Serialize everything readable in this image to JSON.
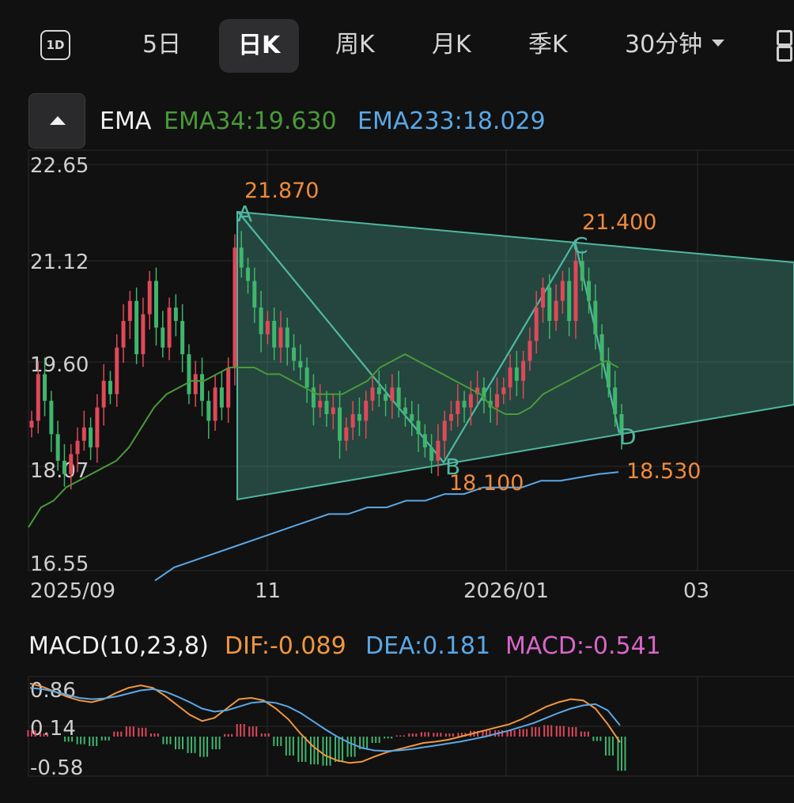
{
  "tabs": {
    "one_day": "1D",
    "items": [
      {
        "label": "5日"
      },
      {
        "label": "日K",
        "active": true
      },
      {
        "label": "周K"
      },
      {
        "label": "月K"
      },
      {
        "label": "季K"
      },
      {
        "label": "30分钟"
      }
    ]
  },
  "colors": {
    "background": "#111111",
    "up_candle": "#e0485a",
    "down_candle": "#3fb56d",
    "ema34": "#4a9a3a",
    "ema233": "#5aa8e6",
    "pattern": "#4fb8a0",
    "annotation": "#ef8a3c",
    "dif": "#f0973f",
    "dea": "#5aa8e6",
    "macd": "#d866c8"
  },
  "ema_legend": {
    "title": "EMA",
    "ema34": "EMA34:19.630",
    "ema233": "EMA233:18.029"
  },
  "macd_legend": {
    "title": "MACD(10,23,8)",
    "dif": "DIF:-0.089",
    "dea": "DEA:0.181",
    "macd": "MACD:-0.541"
  },
  "chart_data": [
    {
      "type": "candlestick",
      "title": "EMA",
      "y_ticks": [
        "22.65",
        "21.12",
        "19.60",
        "18.07",
        "16.55"
      ],
      "ylim": [
        16.55,
        22.65
      ],
      "x_ticks": [
        "2025/09",
        "11",
        "2026/01",
        "03"
      ],
      "grid": true,
      "closes": [
        18.8,
        19.5,
        19.1,
        18.6,
        18.2,
        18.0,
        18.3,
        18.5,
        18.7,
        18.4,
        19.0,
        19.4,
        19.2,
        19.9,
        20.3,
        20.6,
        19.8,
        20.4,
        20.9,
        20.2,
        19.9,
        20.5,
        20.3,
        19.8,
        19.2,
        19.5,
        19.1,
        18.8,
        19.3,
        19.0,
        19.6,
        21.4,
        21.1,
        20.9,
        20.5,
        20.1,
        20.3,
        19.9,
        20.2,
        19.9,
        19.7,
        19.6,
        19.3,
        19.0,
        19.1,
        18.9,
        19.0,
        18.5,
        18.7,
        18.9,
        18.8,
        19.1,
        19.3,
        19.2,
        19.1,
        19.3,
        19.0,
        18.9,
        18.8,
        18.6,
        18.4,
        18.2,
        18.5,
        18.8,
        18.9,
        19.1,
        19.0,
        19.2,
        19.3,
        19.1,
        19.0,
        19.2,
        19.3,
        19.6,
        19.4,
        19.7,
        20.0,
        20.5,
        20.8,
        20.3,
        20.6,
        20.9,
        20.3,
        21.2,
        20.9,
        20.6,
        20.1,
        19.7,
        19.3,
        18.9,
        18.6
      ],
      "ema34": [
        17.2,
        17.5,
        17.6,
        17.8,
        17.9,
        18.0,
        18.1,
        18.2,
        18.4,
        18.7,
        19.0,
        19.2,
        19.3,
        19.4,
        19.4,
        19.5,
        19.6,
        19.6,
        19.6,
        19.5,
        19.5,
        19.4,
        19.3,
        19.2,
        19.2,
        19.2,
        19.3,
        19.4,
        19.6,
        19.7,
        19.8,
        19.7,
        19.6,
        19.5,
        19.4,
        19.3,
        19.2,
        19.0,
        18.9,
        18.9,
        19.0,
        19.2,
        19.3,
        19.4,
        19.5,
        19.6,
        19.7,
        19.6
      ],
      "ema233": [
        16.4,
        16.6,
        16.7,
        16.8,
        16.9,
        17.0,
        17.1,
        17.2,
        17.3,
        17.4,
        17.4,
        17.5,
        17.5,
        17.6,
        17.6,
        17.7,
        17.7,
        17.8,
        17.8,
        17.8,
        17.9,
        17.9,
        17.95,
        18.0,
        18.03
      ],
      "pattern_points": [
        {
          "name": "A",
          "value": "21.870"
        },
        {
          "name": "B",
          "value": "18.100"
        },
        {
          "name": "C",
          "value": "21.400"
        },
        {
          "name": "D",
          "value": "18.530"
        }
      ]
    },
    {
      "type": "macd",
      "title": "MACD(10,23,8)",
      "y_ticks": [
        "0.86",
        "0.14",
        "-0.58"
      ],
      "ylim": [
        -0.58,
        0.86
      ],
      "series": [
        {
          "name": "DIF",
          "values": [
            0.85,
            0.8,
            0.72,
            0.64,
            0.58,
            0.55,
            0.6,
            0.7,
            0.78,
            0.82,
            0.78,
            0.65,
            0.5,
            0.35,
            0.25,
            0.3,
            0.45,
            0.6,
            0.62,
            0.58,
            0.45,
            0.28,
            0.05,
            -0.15,
            -0.3,
            -0.38,
            -0.42,
            -0.4,
            -0.32,
            -0.25,
            -0.2,
            -0.15,
            -0.1,
            -0.08,
            -0.05,
            0.0,
            0.05,
            0.1,
            0.15,
            0.2,
            0.28,
            0.38,
            0.48,
            0.55,
            0.6,
            0.58,
            0.45,
            0.2,
            -0.09
          ]
        },
        {
          "name": "DEA",
          "values": [
            0.78,
            0.76,
            0.72,
            0.67,
            0.62,
            0.6,
            0.61,
            0.64,
            0.69,
            0.74,
            0.76,
            0.72,
            0.64,
            0.55,
            0.45,
            0.4,
            0.42,
            0.48,
            0.54,
            0.56,
            0.54,
            0.48,
            0.38,
            0.25,
            0.12,
            0.0,
            -0.1,
            -0.18,
            -0.22,
            -0.23,
            -0.22,
            -0.2,
            -0.17,
            -0.14,
            -0.11,
            -0.08,
            -0.04,
            0.0,
            0.05,
            0.1,
            0.16,
            0.22,
            0.3,
            0.38,
            0.45,
            0.5,
            0.52,
            0.42,
            0.18
          ]
        }
      ],
      "histogram": [
        0.1,
        0.05,
        0.0,
        -0.08,
        -0.12,
        -0.15,
        -0.06,
        0.08,
        0.16,
        0.14,
        0.05,
        -0.12,
        -0.2,
        -0.26,
        -0.32,
        -0.2,
        0.04,
        0.2,
        0.16,
        0.05,
        -0.15,
        -0.3,
        -0.4,
        -0.44,
        -0.46,
        -0.4,
        -0.32,
        -0.2,
        -0.1,
        -0.03,
        0.02,
        0.05,
        0.07,
        0.06,
        0.05,
        0.06,
        0.09,
        0.1,
        0.1,
        0.1,
        0.12,
        0.15,
        0.18,
        0.17,
        0.15,
        0.08,
        -0.07,
        -0.3,
        -0.54
      ]
    }
  ]
}
